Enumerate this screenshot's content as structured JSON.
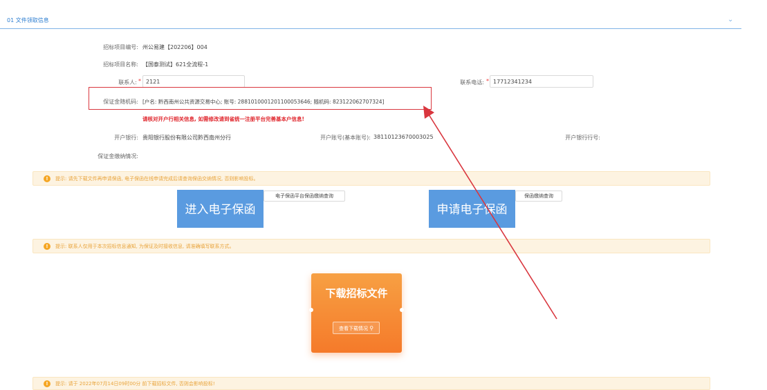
{
  "section": {
    "title": "01  文件领取信息"
  },
  "fields": {
    "project_no_label": "招标项目编号:",
    "project_no_value": "州公易建【202206】004",
    "project_name_label": "招标项目名称:",
    "project_name_value": "【国泰测试】621全流程-1",
    "contact_label": "联系人:",
    "contact_value": "2121",
    "phone_label": "联系电话:",
    "phone_value": "17712341234",
    "deposit_code_label": "保证金随机码:",
    "deposit_code_value": "[户名: 黔西南州公共资源交易中心; 账号: 2881010001201100053646; 随机码: 823122062707324]",
    "warning": "请核对开户行相关信息, 如需修改请到省统一注册平台完善基本户信息!",
    "bank_label": "开户银行:",
    "bank_value": "贵阳银行股份有限公司黔西南州分行",
    "account_label": "开户账号(基本账号):",
    "account_value": "38110123670003025",
    "bank_no_label": "开户银行行号:",
    "payment_status_label": "保证金缴纳情况:"
  },
  "required_mark": "*",
  "tips": {
    "tip1": "提示: 请先下载文件再申请保函, 电子保函在线申请完成后请查询保函交纳情况, 否则影响投标。",
    "tip2": "提示: 联系人仅用于本次招标信息通知, 为保证及时接收信息, 请准确填写联系方式。",
    "tip3": "提示: 请于 2022年07月14日09时00分 前下载招标文件, 否则会影响投标!"
  },
  "buttons": {
    "enter_guarantee": "进入电子保函",
    "guarantee_query": "电子保函平台保函缴纳查询",
    "apply_guarantee": "申请电子保函",
    "guarantee_pay_query": "保函缴纳查询",
    "download_file": "下载招标文件",
    "view_download": "查看下载情况"
  },
  "icons": {
    "collapse": "chevron-down-icon",
    "tip": "info-icon",
    "search": "search-icon"
  },
  "colors": {
    "accent": "#2f7fd1",
    "guarantee_button": "#5a9be0",
    "download_card": "#f57a2a",
    "highlight": "#d9363e",
    "tip_bg": "#fdf3e1"
  }
}
